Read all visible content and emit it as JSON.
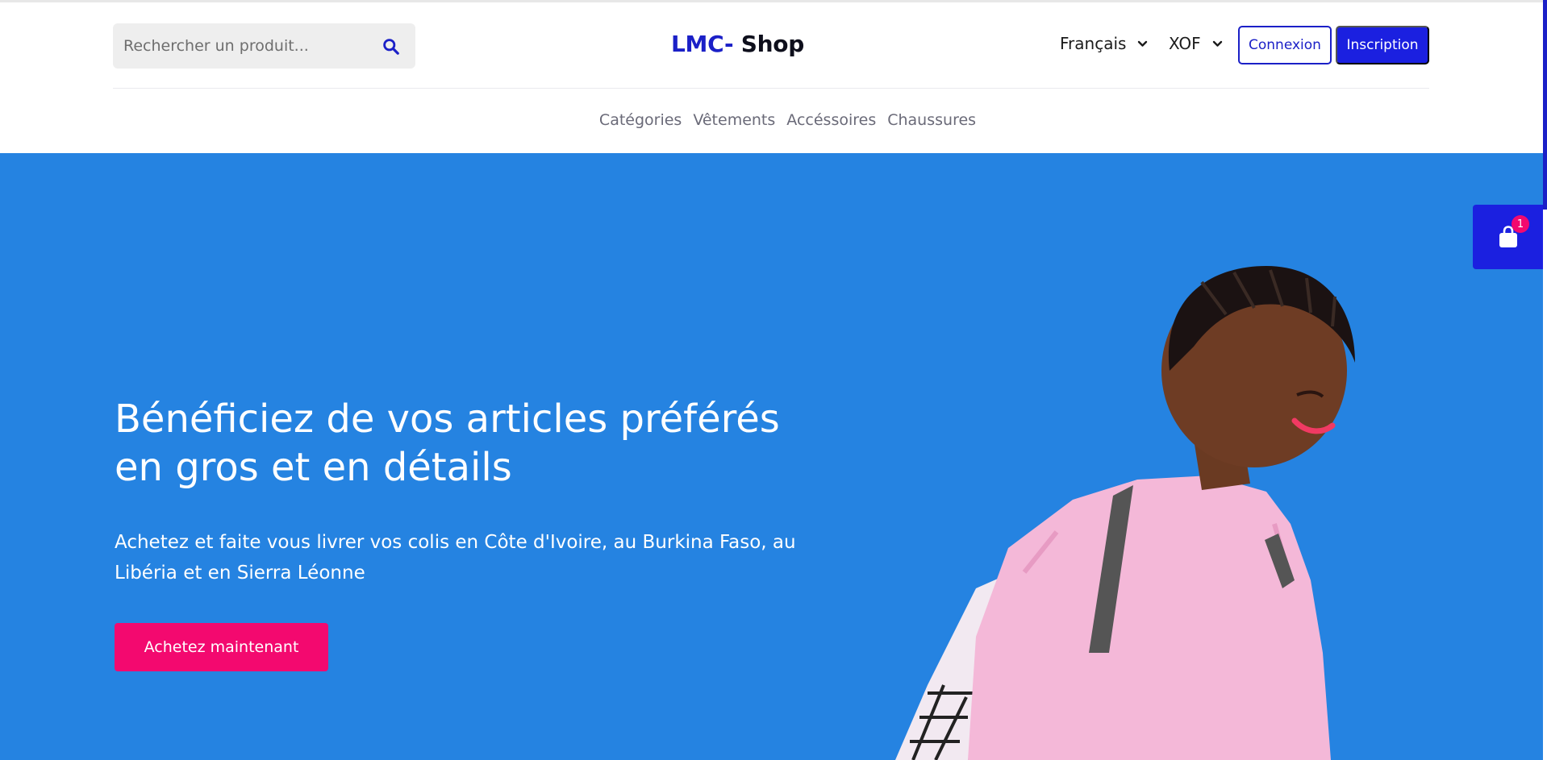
{
  "header": {
    "search_placeholder": "Rechercher un produit...",
    "logo_part1": "LMC-",
    "logo_part2": " Shop",
    "language": "Français",
    "currency": "XOF",
    "login_label": "Connexion",
    "signup_label": "Inscription"
  },
  "nav": {
    "items": [
      {
        "label": "Catégories"
      },
      {
        "label": "Vêtements"
      },
      {
        "label": "Accéssoires"
      },
      {
        "label": "Chaussures"
      }
    ]
  },
  "hero": {
    "title": "Bénéficiez de vos articles préférés\nen gros et en détails",
    "subtitle": "Achetez et faite vous livrer vos colis en Côte d'Ivoire, au Burkina Faso, au Libéria et en Sierra Léonne",
    "cta_label": "Achetez maintenant",
    "background_color": "#2583e1"
  },
  "cart": {
    "count": "1"
  },
  "colors": {
    "brand_blue": "#1b20c7",
    "accent_pink": "#f3096f"
  },
  "icons": [
    "search-icon",
    "chevron-down-icon",
    "shopping-bag-icon"
  ]
}
